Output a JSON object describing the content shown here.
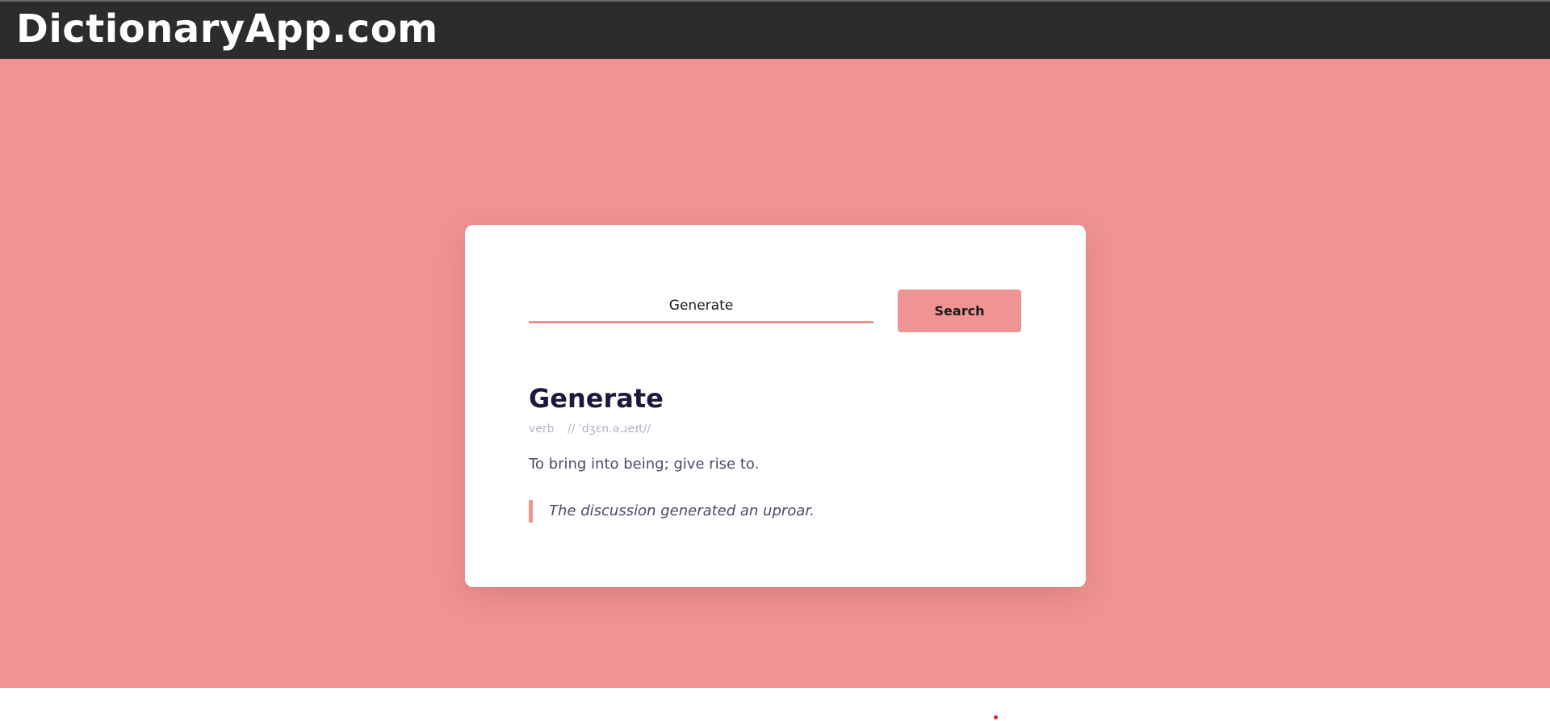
{
  "header": {
    "brand": "DictionaryApp.com"
  },
  "search": {
    "value": "Generate",
    "button_label": "Search"
  },
  "result": {
    "word": "Generate",
    "part_of_speech": "verb",
    "phonetic": "// ˈdʒɛn.ə.ɹeɪt//",
    "definition": "To bring into being; give rise to.",
    "example": "The discussion generated an uproar."
  },
  "colors": {
    "accent": "#f09393",
    "header_bg": "#2e2b2c",
    "title_text": "#1b1a3d",
    "body_text": "#4d4b66",
    "muted_text": "#b4b1c4"
  }
}
